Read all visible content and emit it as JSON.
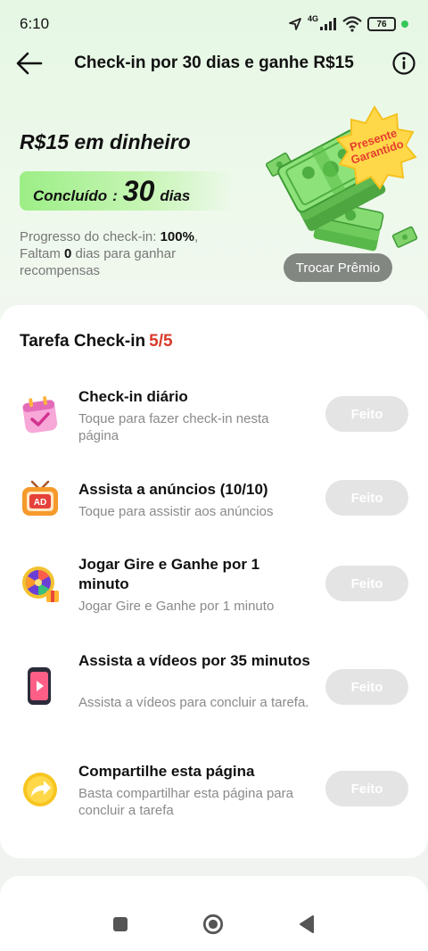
{
  "status_bar": {
    "time": "6:10",
    "network": "4G",
    "battery": "76"
  },
  "header": {
    "title": "Check-in por 30 dias e ganhe R$15",
    "back_icon": "arrow-left-icon",
    "info_icon": "info-icon"
  },
  "reward": {
    "title": "R$15 em dinheiro",
    "done_label": "Concluído",
    "done_sep": ":",
    "done_days": "30",
    "done_unit": "dias",
    "progress_prefix": "Progresso do check-in: ",
    "progress_value": "100%",
    "progress_suffix": ",",
    "remaining_prefix": "Faltam ",
    "remaining_value": "0",
    "remaining_suffix": " dias para ganhar recompensas",
    "badge_line1": "Presente",
    "badge_line2": "Garantido",
    "exchange_button": "Trocar Prêmio"
  },
  "tasks": {
    "heading": "Tarefa Check-in",
    "count": "5/5",
    "items": [
      {
        "name": "Check-in diário",
        "desc": "Toque para fazer check-in nesta página",
        "button": "Feito",
        "icon": "calendar-check-icon"
      },
      {
        "name": "Assista a anúncios  (10/10)",
        "desc": "Toque para assistir aos anúncios",
        "button": "Feito",
        "icon": "ad-tv-icon"
      },
      {
        "name": "Jogar Gire e Ganhe por 1 minuto",
        "desc": "Jogar Gire e Ganhe por 1 minuto",
        "button": "Feito",
        "icon": "prize-wheel-icon"
      },
      {
        "name": "Assista a vídeos por 35 minutos",
        "desc": "Assista a vídeos para concluir a tarefa.",
        "button": "Feito",
        "icon": "phone-video-icon"
      },
      {
        "name": "Compartilhe esta página",
        "desc": "Basta compartilhar esta página para concluir a tarefa",
        "button": "Feito",
        "icon": "share-arrow-icon"
      }
    ]
  },
  "colors": {
    "accent_red": "#d93b2b",
    "pill_green": "#9cee86",
    "done_button": "#e4e4e4"
  }
}
